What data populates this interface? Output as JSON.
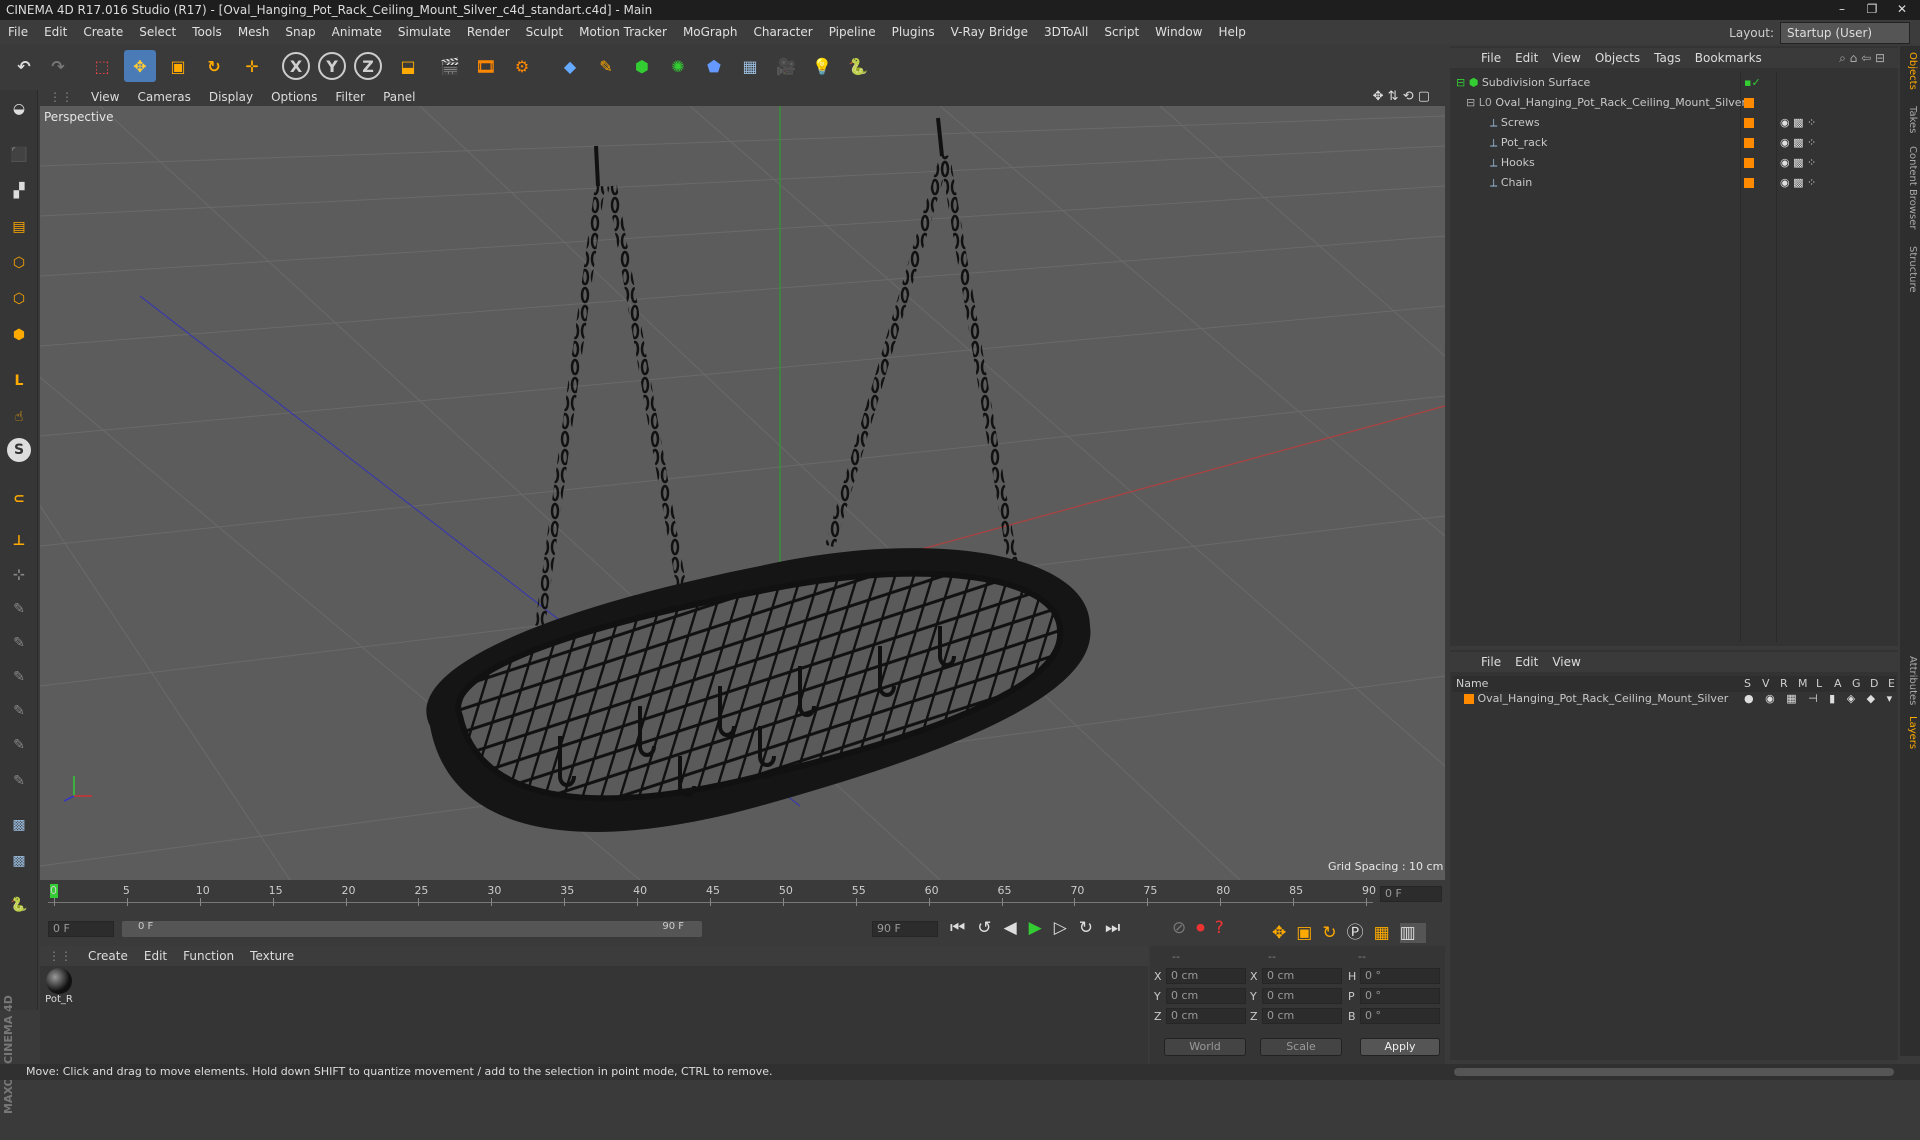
{
  "window": {
    "title": "CINEMA 4D R17.016 Studio (R17) - [Oval_Hanging_Pot_Rack_Ceiling_Mount_Silver_c4d_standart.c4d] - Main"
  },
  "menubar": {
    "items": [
      "File",
      "Edit",
      "Create",
      "Select",
      "Tools",
      "Mesh",
      "Snap",
      "Animate",
      "Simulate",
      "Render",
      "Sculpt",
      "Motion Tracker",
      "MoGraph",
      "Character",
      "Pipeline",
      "Plugins",
      "V-Ray Bridge",
      "3DToAll",
      "Script",
      "Window",
      "Help"
    ]
  },
  "layout": {
    "label": "Layout:",
    "value": "Startup (User)"
  },
  "viewport": {
    "menu": [
      "View",
      "Cameras",
      "Display",
      "Options",
      "Filter",
      "Panel"
    ],
    "camera": "Perspective",
    "grid_spacing": "Grid Spacing : 10 cm"
  },
  "timeline": {
    "ticks": [
      "0",
      "5",
      "10",
      "15",
      "20",
      "25",
      "30",
      "35",
      "40",
      "45",
      "50",
      "55",
      "60",
      "65",
      "70",
      "75",
      "80",
      "85",
      "90"
    ],
    "current_frame": "0 F"
  },
  "transport": {
    "start": "0 F",
    "range_start": "0 F",
    "range_end": "90 F",
    "end": "90 F"
  },
  "materials": {
    "menu": [
      "Create",
      "Edit",
      "Function",
      "Texture"
    ],
    "items": [
      {
        "label": "Pot_R"
      }
    ]
  },
  "coords": {
    "header": [
      "--",
      "--",
      "--"
    ],
    "rows": [
      {
        "a": "X",
        "av": "0 cm",
        "b": "X",
        "bv": "0 cm",
        "c": "H",
        "cv": "0 °"
      },
      {
        "a": "Y",
        "av": "0 cm",
        "b": "Y",
        "bv": "0 cm",
        "c": "P",
        "cv": "0 °"
      },
      {
        "a": "Z",
        "av": "0 cm",
        "b": "Z",
        "bv": "0 cm",
        "c": "B",
        "cv": "0 °"
      }
    ],
    "mode": "World",
    "scale": "Scale",
    "apply": "Apply"
  },
  "objects": {
    "menu": [
      "File",
      "Edit",
      "View",
      "Objects",
      "Tags",
      "Bookmarks"
    ],
    "tree": [
      {
        "name": "Subdivision Surface",
        "level": 0
      },
      {
        "name": "Oval_Hanging_Pot_Rack_Ceiling_Mount_Silver",
        "level": 1
      },
      {
        "name": "Screws",
        "level": 2
      },
      {
        "name": "Pot_rack",
        "level": 2
      },
      {
        "name": "Hooks",
        "level": 2
      },
      {
        "name": "Chain",
        "level": 2
      }
    ]
  },
  "layers": {
    "menu": [
      "File",
      "Edit",
      "View"
    ],
    "name_header": "Name",
    "cols": [
      "S",
      "V",
      "R",
      "M",
      "L",
      "A",
      "G",
      "D",
      "E"
    ],
    "rows": [
      {
        "name": "Oval_Hanging_Pot_Rack_Ceiling_Mount_Silver"
      }
    ]
  },
  "sidetabs": [
    "Objects",
    "Takes",
    "Content Browser",
    "Structure",
    "Attributes",
    "Layers"
  ],
  "branding": {
    "maxon": "MAXON",
    "c4d": "CINEMA 4D"
  },
  "status": {
    "text": "Move: Click and drag to move elements. Hold down SHIFT to quantize movement / add to the selection in point mode, CTRL to remove."
  },
  "colors": {
    "accent": "#ff8a00",
    "active_blue": "#4a7bb7",
    "red_axis": "#c43a3a",
    "green_axis": "#3ac43a",
    "blue_axis": "#3a3ac4"
  }
}
